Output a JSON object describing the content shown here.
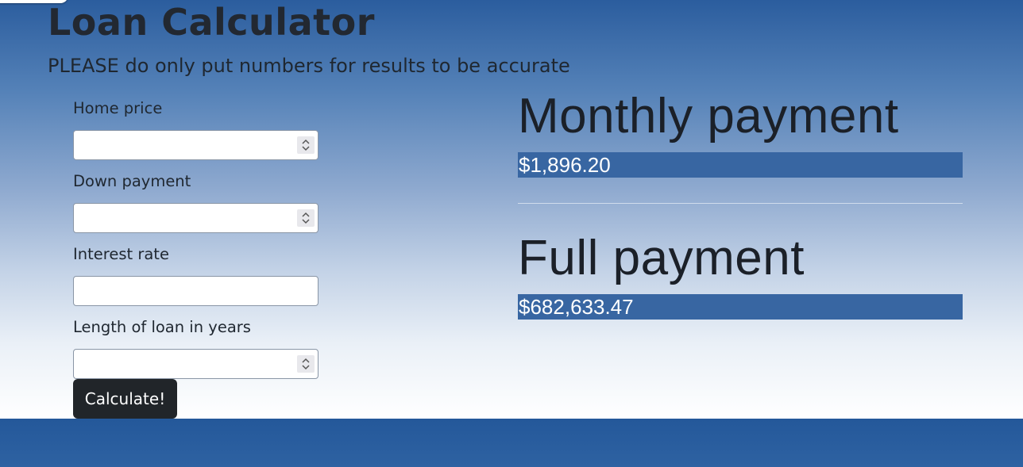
{
  "header": {
    "title": "Loan Calculator",
    "subtitle": "PLEASE do only put numbers for results to be accurate"
  },
  "form": {
    "fields": [
      {
        "label": "Home price",
        "value": "",
        "type": "number"
      },
      {
        "label": "Down payment",
        "value": "",
        "type": "number"
      },
      {
        "label": "Interest rate",
        "value": "",
        "type": "text"
      },
      {
        "label": "Length of loan in years",
        "value": "",
        "type": "number"
      }
    ],
    "submit_label": "Calculate!"
  },
  "results": {
    "monthly": {
      "heading": "Monthly payment",
      "value": "$1,896.20"
    },
    "full": {
      "heading": "Full payment",
      "value": "$682,633.47"
    }
  },
  "colors": {
    "result_bar": "#3866a2",
    "button": "#212529",
    "footer": "#2a5b9c"
  }
}
